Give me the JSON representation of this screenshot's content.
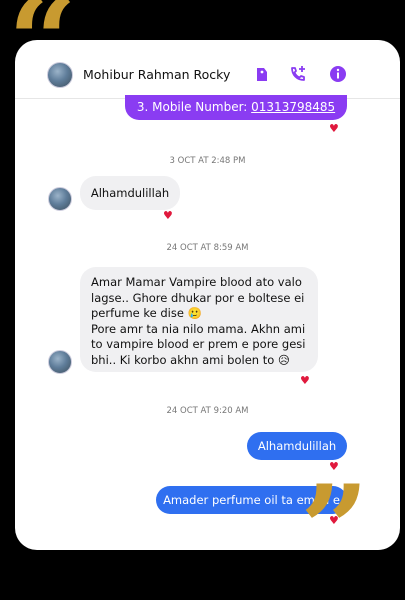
{
  "header": {
    "contact_name": "Mohibur Rahman Rocky"
  },
  "icons": [
    "tag-icon",
    "video-call-icon",
    "info-icon"
  ],
  "colors": {
    "accent": "#8a3cf2",
    "outgoing": "#2f6ff0",
    "heart": "#e0193d",
    "quote": "#c89a30"
  },
  "messages": {
    "m1": {
      "prefix": "3. Mobile Number: ",
      "number": "01313798485"
    },
    "ts1": "3 OCT AT 2:48 PM",
    "m2": "Alhamdulillah",
    "ts2": "24 OCT AT 8:59 AM",
    "m3": {
      "line1": "Amar Mamar Vampire blood ato valo",
      "line2": "lagse..  Ghore dhukar por e boltese ei",
      "line3": "perfume ke dise 🥲",
      "line4": "Pore amr ta nia nilo mama. Akhn ami",
      "line5": "to vampire blood er prem e pore gesi",
      "line6": "bhi.. Ki korbo akhn ami bolen to 😥"
    },
    "ts3": "24 OCT AT 9:20 AM",
    "m4": "Alhamdulillah",
    "m5": "Amader perfume oil ta emon e"
  },
  "reactions": {
    "heart": "♥"
  },
  "quotes": {
    "open": "“",
    "close": "”"
  }
}
